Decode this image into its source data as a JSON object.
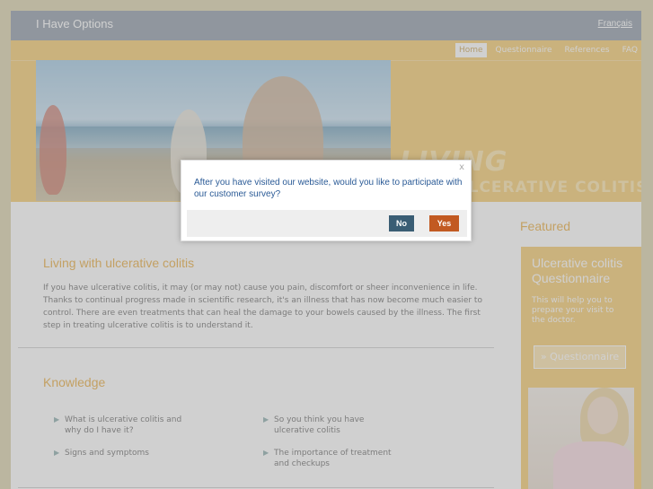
{
  "site": {
    "title": "I Have Options",
    "language_link": "Français"
  },
  "nav": {
    "items": [
      "Home",
      "Questionnaire",
      "References",
      "FAQ"
    ],
    "active": "Home"
  },
  "hero": {
    "title": "LIVING",
    "subtitle": "WITH ULCERATIVE COLITIS"
  },
  "main": {
    "intro_title": "Living with ulcerative colitis",
    "intro_text": "If you have ulcerative colitis, it may (or may not) cause you pain, discomfort or sheer inconvenience in life. Thanks to continual progress made in scientific research, it's an illness that has now become much easier to control. There are even treatments that can heal the damage to your bowels caused by the illness. The first step in treating ulcerative colitis is to understand it.",
    "knowledge_title": "Knowledge",
    "knowledge_items": [
      "What is ulcerative colitis and why do I have it?",
      "So you think you have ulcerative colitis",
      "Signs and symptoms",
      "The importance of treatment and checkups"
    ]
  },
  "sidebar": {
    "featured_label": "Featured",
    "questionnaire_title": "Ulcerative colitis Questionnaire",
    "questionnaire_text": "This will help you to prepare your visit to the doctor.",
    "questionnaire_button": "» Questionnaire"
  },
  "dialog": {
    "close": "x",
    "message": "After you have visited our website, would you like to participate with our customer survey?",
    "no_label": "No",
    "yes_label": "Yes"
  },
  "colors": {
    "accent": "#f5c868",
    "heading": "#e8a838",
    "no_button": "#3a5d74",
    "yes_button": "#c25a22",
    "dialog_text": "#2a5a96"
  }
}
